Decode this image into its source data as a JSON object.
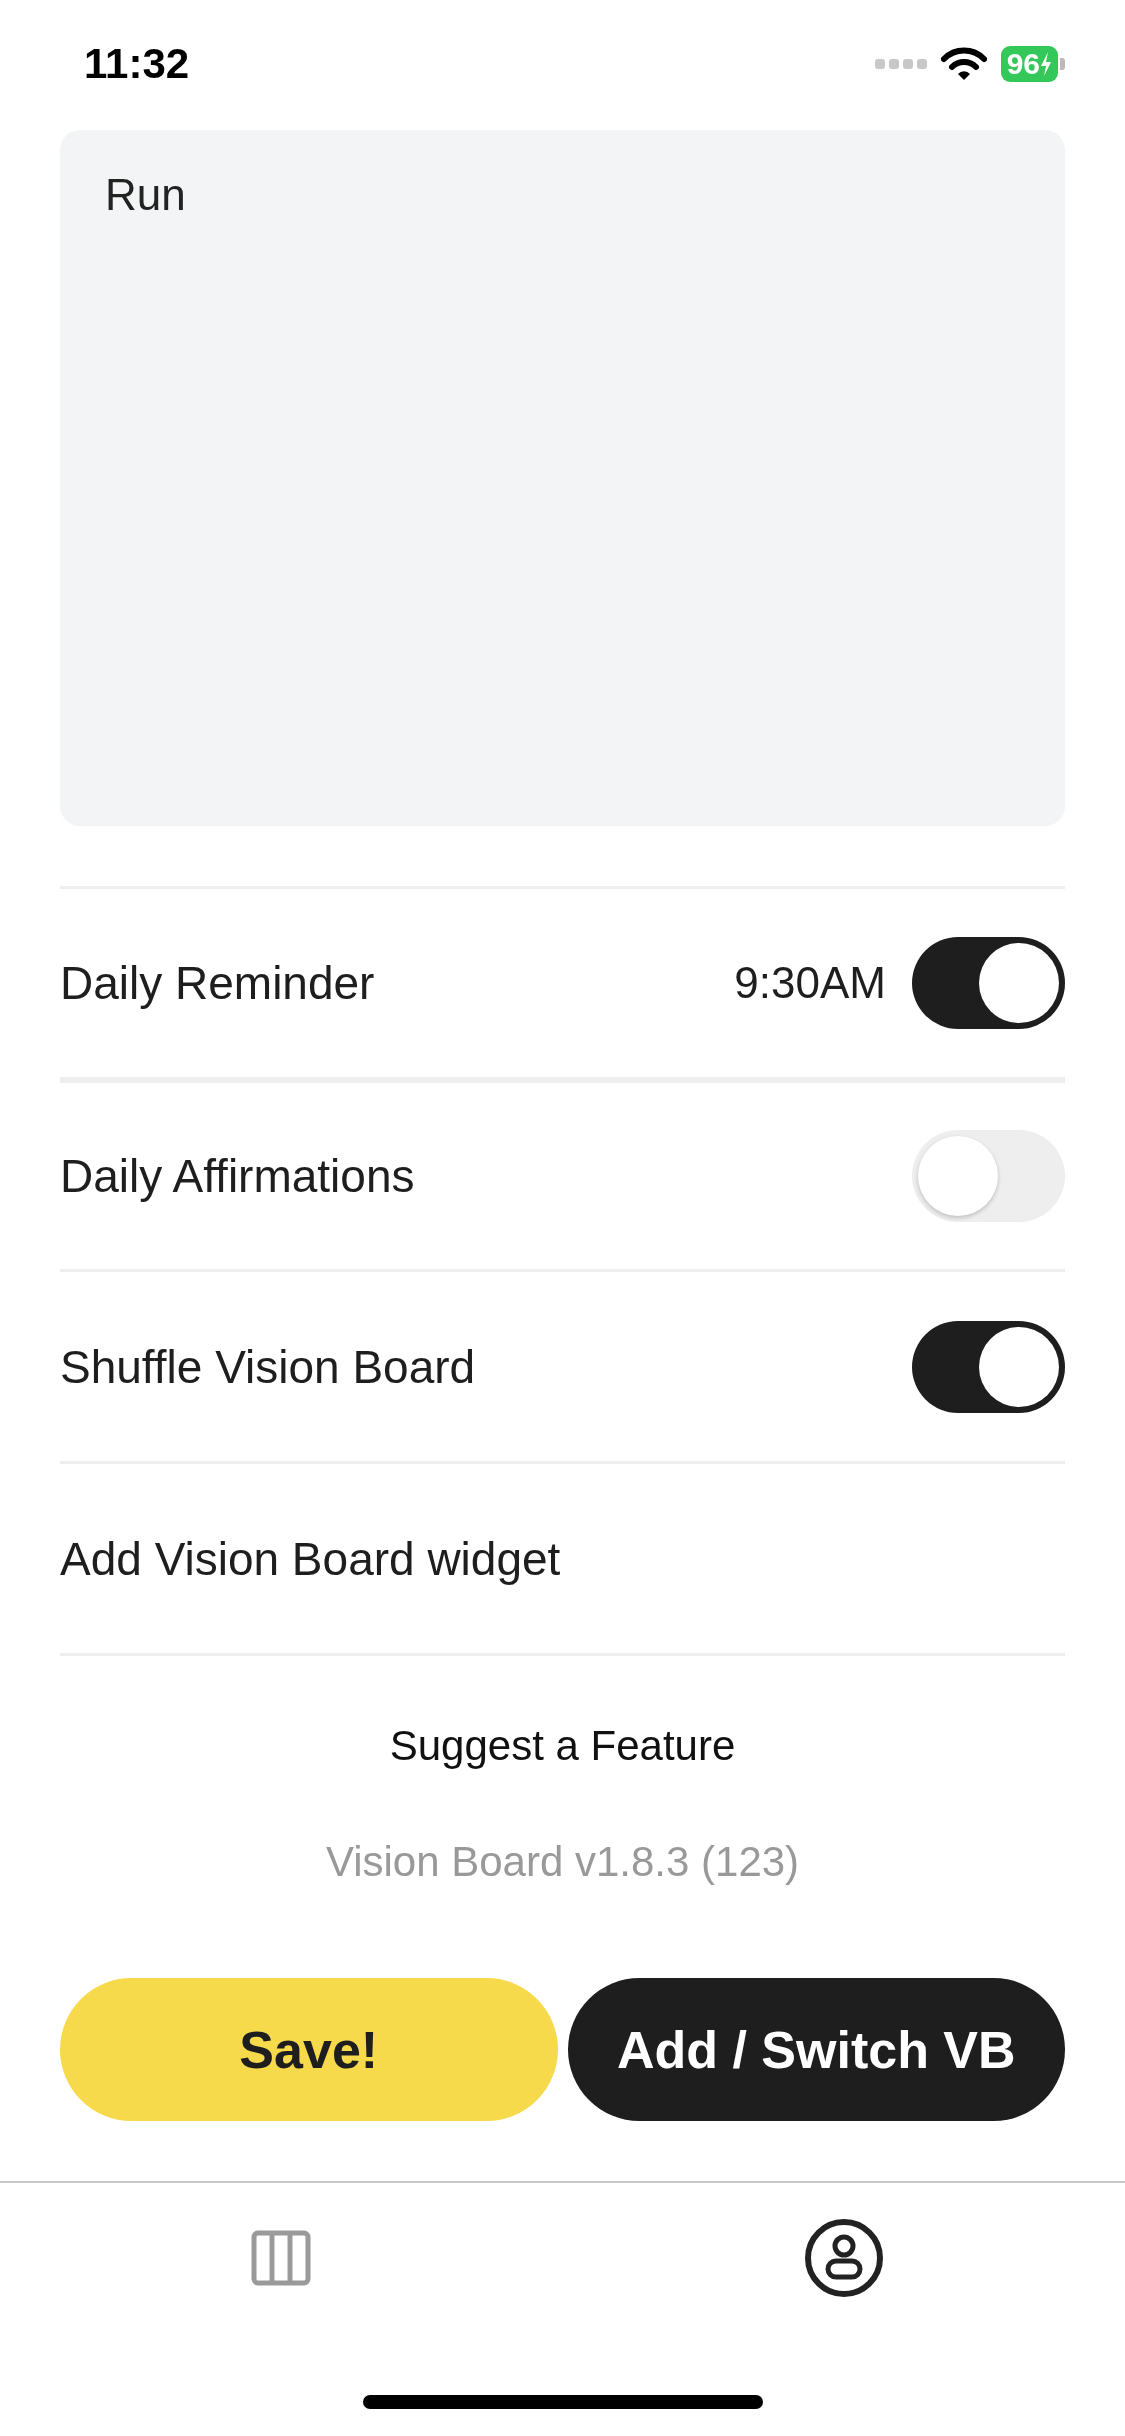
{
  "status_bar": {
    "time": "11:32",
    "battery": "96"
  },
  "goal_text": {
    "value": "Run"
  },
  "settings": [
    {
      "kind": "toggle",
      "label": "Daily Reminder",
      "time": "9:30AM",
      "on": true
    },
    {
      "kind": "toggle",
      "label": "Daily Affirmations",
      "on": false
    },
    {
      "kind": "toggle",
      "label": "Shuffle Vision Board",
      "on": true
    },
    {
      "kind": "link",
      "label": "Add Vision Board widget"
    }
  ],
  "suggest_link": "Suggest a Feature",
  "version": "Vision Board v1.8.3 (123)",
  "buttons": [
    {
      "label": "Save!",
      "kind": "primary"
    },
    {
      "label": "Add / Switch VB",
      "kind": "dark"
    }
  ],
  "tabs": [
    {
      "kind": "columns",
      "selected": false
    },
    {
      "kind": "profile",
      "selected": true
    }
  ]
}
